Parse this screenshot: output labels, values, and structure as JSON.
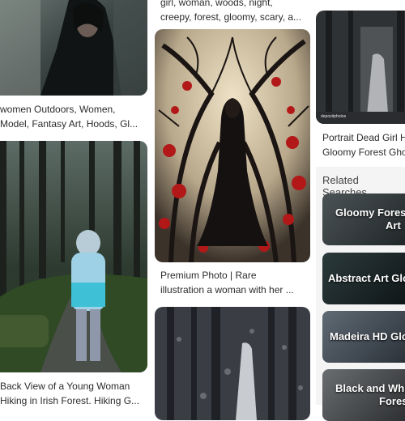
{
  "cards": [
    {
      "line1": "women Outdoors, Women,",
      "line2": "Model, Fantasy Art, Hoods, Gl..."
    },
    {
      "line1": "Back View of a Young Woman",
      "line2": "Hiking in Irish Forest. Hiking G..."
    },
    {
      "line1": "girl, woman, woods, night,",
      "line2": "creepy, forest, gloomy, scary, a..."
    },
    {
      "line1": "Premium Photo | Rare",
      "line2": "illustration a woman with her ..."
    },
    {
      "line1": "Portrait Dead Girl H",
      "line2": "Gloomy Forest Gho"
    }
  ],
  "related": {
    "title": "Related Searches",
    "items": [
      {
        "line1": "Gloomy Forest",
        "line2": "Art"
      },
      {
        "line1": "Abstract Art Glo",
        "line2": ""
      },
      {
        "line1": "Madeira HD Glo",
        "line2": ""
      },
      {
        "line1": "Black and Whi",
        "line2": "Fores"
      }
    ]
  },
  "watermark": "depositphotos"
}
